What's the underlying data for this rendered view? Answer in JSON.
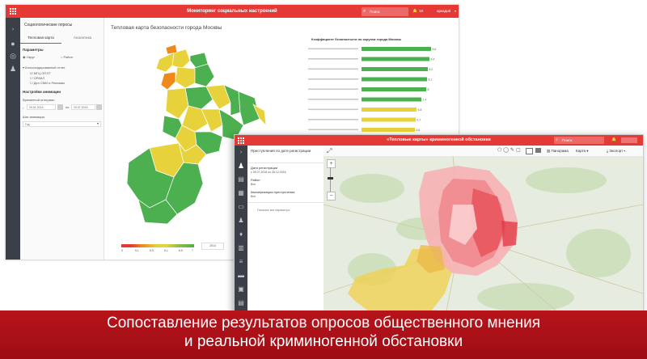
{
  "window1": {
    "title": "Мониторинг социальных настроений",
    "search_placeholder": "Поиск",
    "notif_count": "10",
    "user": "аркадий",
    "panel": {
      "heading": "Социологические опросы",
      "tabs": [
        "Тепловая карта",
        "Аналитика"
      ],
      "params_label": "Параметры",
      "radio_options": [
        "Округ",
        "Район"
      ],
      "tree_root": "Консолидированный отчет",
      "tree_items": [
        "МГЦ ОПЭТ",
        "ОРАКЛ",
        "Дел СМИ и Рекламы"
      ],
      "anim_label": "Настройки анимации",
      "interval_label": "Временной интервал",
      "date_from": "29.01.2014",
      "date_to": "29.07.2016",
      "to_label": "по",
      "step_label": "Шаг анимации",
      "step_value": "Год"
    },
    "map_title": "Тепловая карта безопасности города Москвы",
    "chart_title": "Коэффициент безопасности по округам города Москвы",
    "legend_ticks": [
      "0",
      "5.1",
      "5.5",
      "6.1",
      "6.5",
      "7"
    ],
    "legend_value": "2014"
  },
  "chart_data": {
    "type": "bar",
    "title": "Коэффициент безопасности по округам города Москвы",
    "orientation": "horizontal",
    "values": [
      8.6,
      8.4,
      8.2,
      8.1,
      8.0,
      7.4,
      6.8,
      6.7,
      6.6,
      6.3
    ],
    "colors": [
      "#4caf50",
      "#4caf50",
      "#4caf50",
      "#4caf50",
      "#4caf50",
      "#4caf50",
      "#e8d23b",
      "#e8d23b",
      "#e8d23b",
      "#e8d23b"
    ]
  },
  "window2": {
    "title": "«Тепловые карты» криминогенной обстановки",
    "search_placeholder": "Поиск",
    "panel": {
      "header": "Преступления по дате регистрации",
      "fields": [
        {
          "label": "Дата регистрации",
          "value": "с 26.07.2016 по 26.12.2016"
        },
        {
          "label": "Район",
          "value": "Все"
        },
        {
          "label": "Квалификация преступления",
          "value": "Все"
        }
      ],
      "show_all": "Показать все параметры"
    },
    "toolbar": {
      "panorama": "Панорама",
      "map_type": "Карта",
      "export": "Экспорт"
    }
  },
  "caption": {
    "line1": "Сопоставление результатов опросов общественного мнения",
    "line2": "и реальной криминогенной обстановки"
  },
  "colors": {
    "accent": "#e53935",
    "sidebar": "#3b3f47",
    "green": "#4caf50",
    "yellow": "#e8d23b",
    "orange": "#ef8a1a",
    "caption_bg": "#a8111a"
  }
}
